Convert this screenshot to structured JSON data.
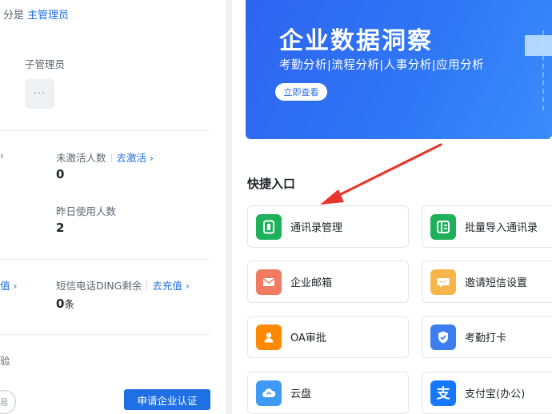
{
  "left": {
    "role_text": "分是",
    "role_link": "主管理员",
    "sub_admin_label": "子管理员",
    "more_glyph": "···",
    "stats": {
      "unactivated_label": "未激活人数",
      "unactivated_link": "去激活 ›",
      "unactivated_value": "0",
      "yesterday_label": "昨日使用人数",
      "yesterday_value": "2",
      "ding_label": "短信电话DING剩余",
      "ding_link": "去充值 ›",
      "ding_value": "0",
      "ding_unit": "条"
    },
    "edge_mark_1": "›",
    "edge_link_2": "值 ›",
    "edge_text_3": "验",
    "apply_button": "申请企业认证",
    "badge_text": "易"
  },
  "banner": {
    "title": "企业数据洞察",
    "subtitle": "考勤分析|流程分析|人事分析|应用分析",
    "button": "立即查看"
  },
  "quick": {
    "title": "快捷入口",
    "items": [
      {
        "label": "通讯录管理",
        "color": "#1fb15a",
        "icon": "contacts-book-icon"
      },
      {
        "label": "批量导入通讯录",
        "color": "#1fb15a",
        "icon": "import-contacts-icon"
      },
      {
        "label": "企业邮箱",
        "color": "#f07a62",
        "icon": "mail-icon"
      },
      {
        "label": "邀请短信设置",
        "color": "#f8b54a",
        "icon": "sms-chat-icon"
      },
      {
        "label": "OA审批",
        "color": "#ff8a00",
        "icon": "approval-person-icon"
      },
      {
        "label": "考勤打卡",
        "color": "#3c7ef0",
        "icon": "attendance-shield-icon"
      },
      {
        "label": "云盘",
        "color": "#3f9af5",
        "icon": "cloud-disk-icon"
      },
      {
        "label": "支付宝(办公)",
        "color": "#1677ff",
        "icon": "alipay-icon"
      }
    ]
  },
  "colors": {
    "accent": "#1f6fe5",
    "annotation_arrow": "#e8372e"
  }
}
